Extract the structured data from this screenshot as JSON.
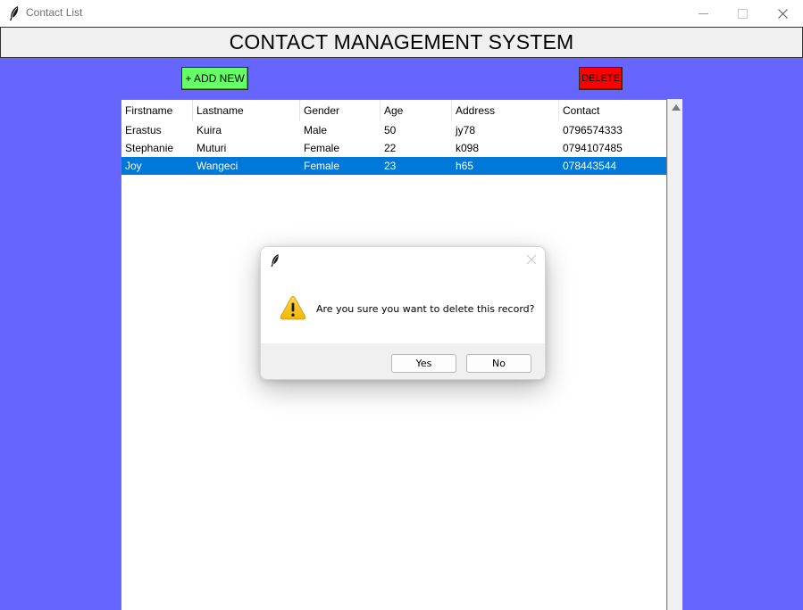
{
  "window": {
    "title": "Contact List",
    "icon": "feather-icon"
  },
  "header": {
    "title": "CONTACT MANAGEMENT SYSTEM"
  },
  "toolbar": {
    "add_label": "+ ADD NEW",
    "delete_label": "DELETE",
    "add_color": "#66ff66",
    "delete_color": "#ff0000"
  },
  "table": {
    "columns": [
      "Firstname",
      "Lastname",
      "Gender",
      "Age",
      "Address",
      "Contact"
    ],
    "rows": [
      [
        "Erastus",
        "Kuira",
        "Male",
        "50",
        "jy78",
        "0796574333"
      ],
      [
        "Stephanie",
        "Muturi",
        "Female",
        "22",
        "k098",
        "0794107485"
      ],
      [
        "Joy",
        "Wangeci",
        "Female",
        "23",
        "h65",
        "078443544"
      ]
    ],
    "selected_row": 2,
    "selection_color": "#0078d7"
  },
  "dialog": {
    "icon": "warning-icon",
    "message": "Are you sure you want to delete this record?",
    "yes_label": "Yes",
    "no_label": "No"
  },
  "colors": {
    "background": "#6666ff"
  }
}
